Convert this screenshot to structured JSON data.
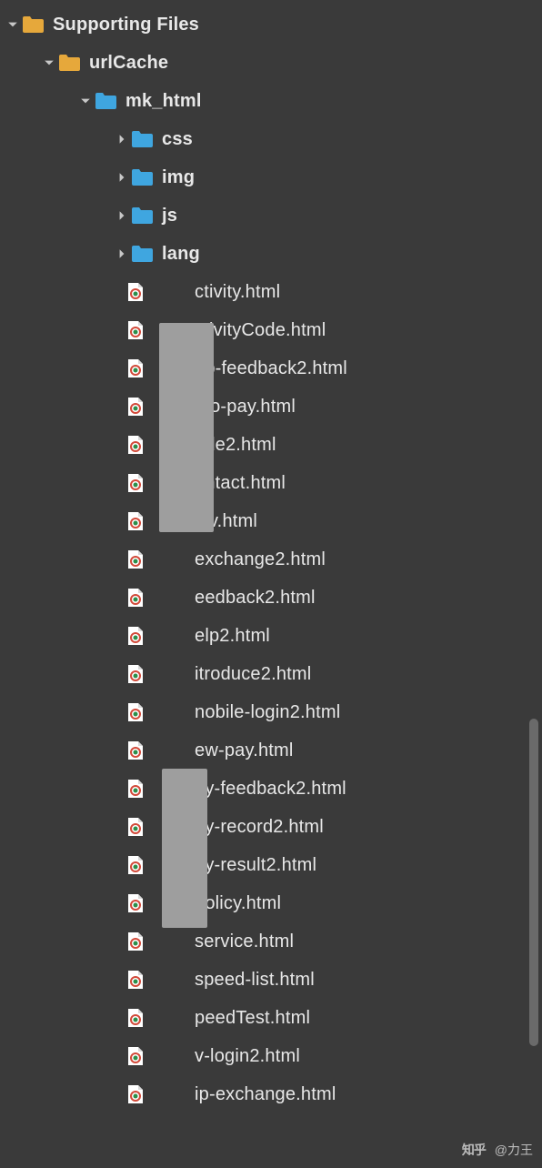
{
  "tree": {
    "root": {
      "name": "Supporting Files",
      "expanded": true,
      "color": "#e6a83b"
    },
    "urlCache": {
      "name": "urlCache",
      "expanded": true,
      "color": "#e6a83b"
    },
    "mk_html": {
      "name": "mk_html",
      "expanded": true,
      "color": "#3fa6e0"
    },
    "subfolders": [
      {
        "name": "css",
        "expanded": false,
        "color": "#3fa6e0"
      },
      {
        "name": "img",
        "expanded": false,
        "color": "#3fa6e0"
      },
      {
        "name": "js",
        "expanded": false,
        "color": "#3fa6e0"
      },
      {
        "name": "lang",
        "expanded": false,
        "color": "#3fa6e0"
      }
    ],
    "files": [
      "ctivity.html",
      "ctivityCode.html",
      "pp-feedback2.html",
      "uto-pay.html",
      "ode2.html",
      "ontact.html",
      "lev.html",
      "exchange2.html",
      "eedback2.html",
      "elp2.html",
      "itroduce2.html",
      "nobile-login2.html",
      "ew-pay.html",
      "ay-feedback2.html",
      "ay-record2.html",
      "ay-result2.html",
      "oolicy.html",
      "service.html",
      "speed-list.html",
      "peedTest.html",
      "v-login2.html",
      "ip-exchange.html"
    ]
  },
  "watermark": {
    "logo": "知乎",
    "author": "@力王"
  }
}
